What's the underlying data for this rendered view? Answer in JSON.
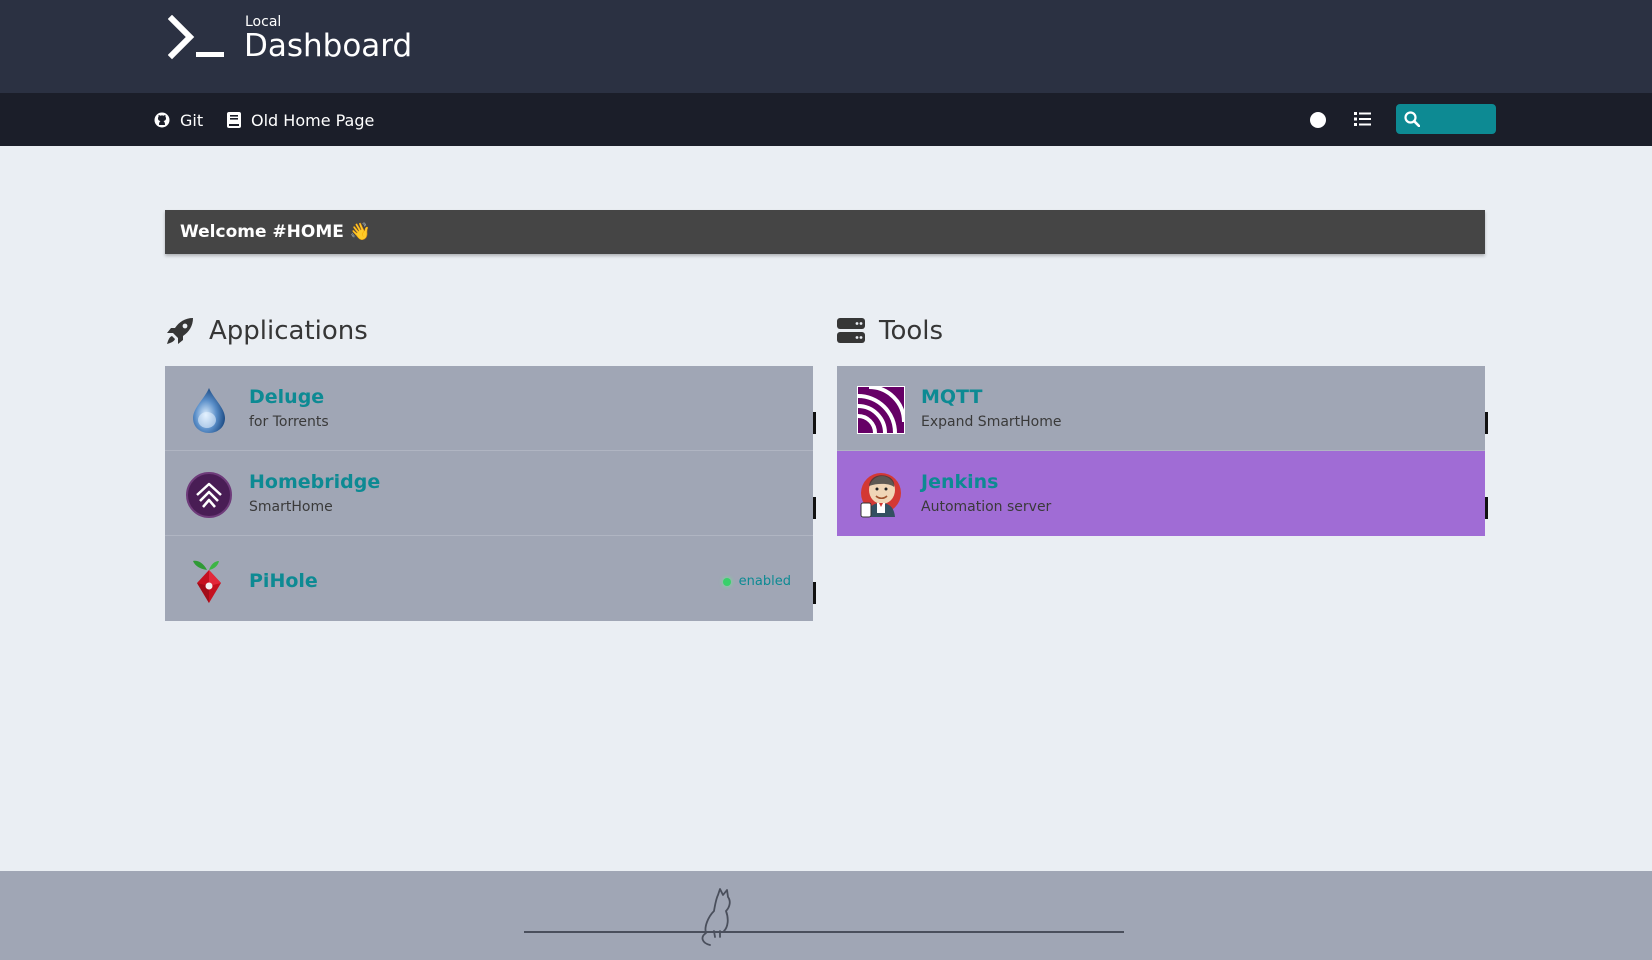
{
  "header": {
    "subtitle": "Local",
    "title": "Dashboard",
    "logo_icon": "terminal-prompt-icon"
  },
  "navbar": {
    "links": [
      {
        "label": "Git",
        "icon": "github-icon"
      },
      {
        "label": "Old Home Page",
        "icon": "book-icon"
      }
    ],
    "theme_toggle_icon": "dark-mode-toggle-icon",
    "layout_toggle_icon": "list-layout-icon",
    "search": {
      "icon": "search-icon",
      "value": "",
      "placeholder": ""
    }
  },
  "message": {
    "text": "Welcome #HOME 👋"
  },
  "groups": [
    {
      "name": "Applications",
      "icon": "rocket-icon",
      "items": [
        {
          "name": "Deluge",
          "subtitle": "for Torrents",
          "logo": "deluge-logo"
        },
        {
          "name": "Homebridge",
          "subtitle": "SmartHome",
          "logo": "homebridge-logo"
        },
        {
          "name": "PiHole",
          "subtitle": "",
          "logo": "pihole-logo",
          "status": "enabled"
        }
      ]
    },
    {
      "name": "Tools",
      "icon": "server-icon",
      "items": [
        {
          "name": "MQTT",
          "subtitle": "Expand SmartHome",
          "logo": "mqtt-logo"
        },
        {
          "name": "Jenkins",
          "subtitle": "Automation server",
          "logo": "jenkins-logo",
          "background": "#a06cd5"
        }
      ]
    }
  ],
  "colors": {
    "header": "#2b3142",
    "navbar": "#1b1e29",
    "accent": "#0d8a93",
    "card": "#a0a6b5",
    "highlight": "#a06cd5",
    "status_ok": "#38d06a"
  },
  "footer": {
    "icon": "cat-on-line-icon"
  }
}
